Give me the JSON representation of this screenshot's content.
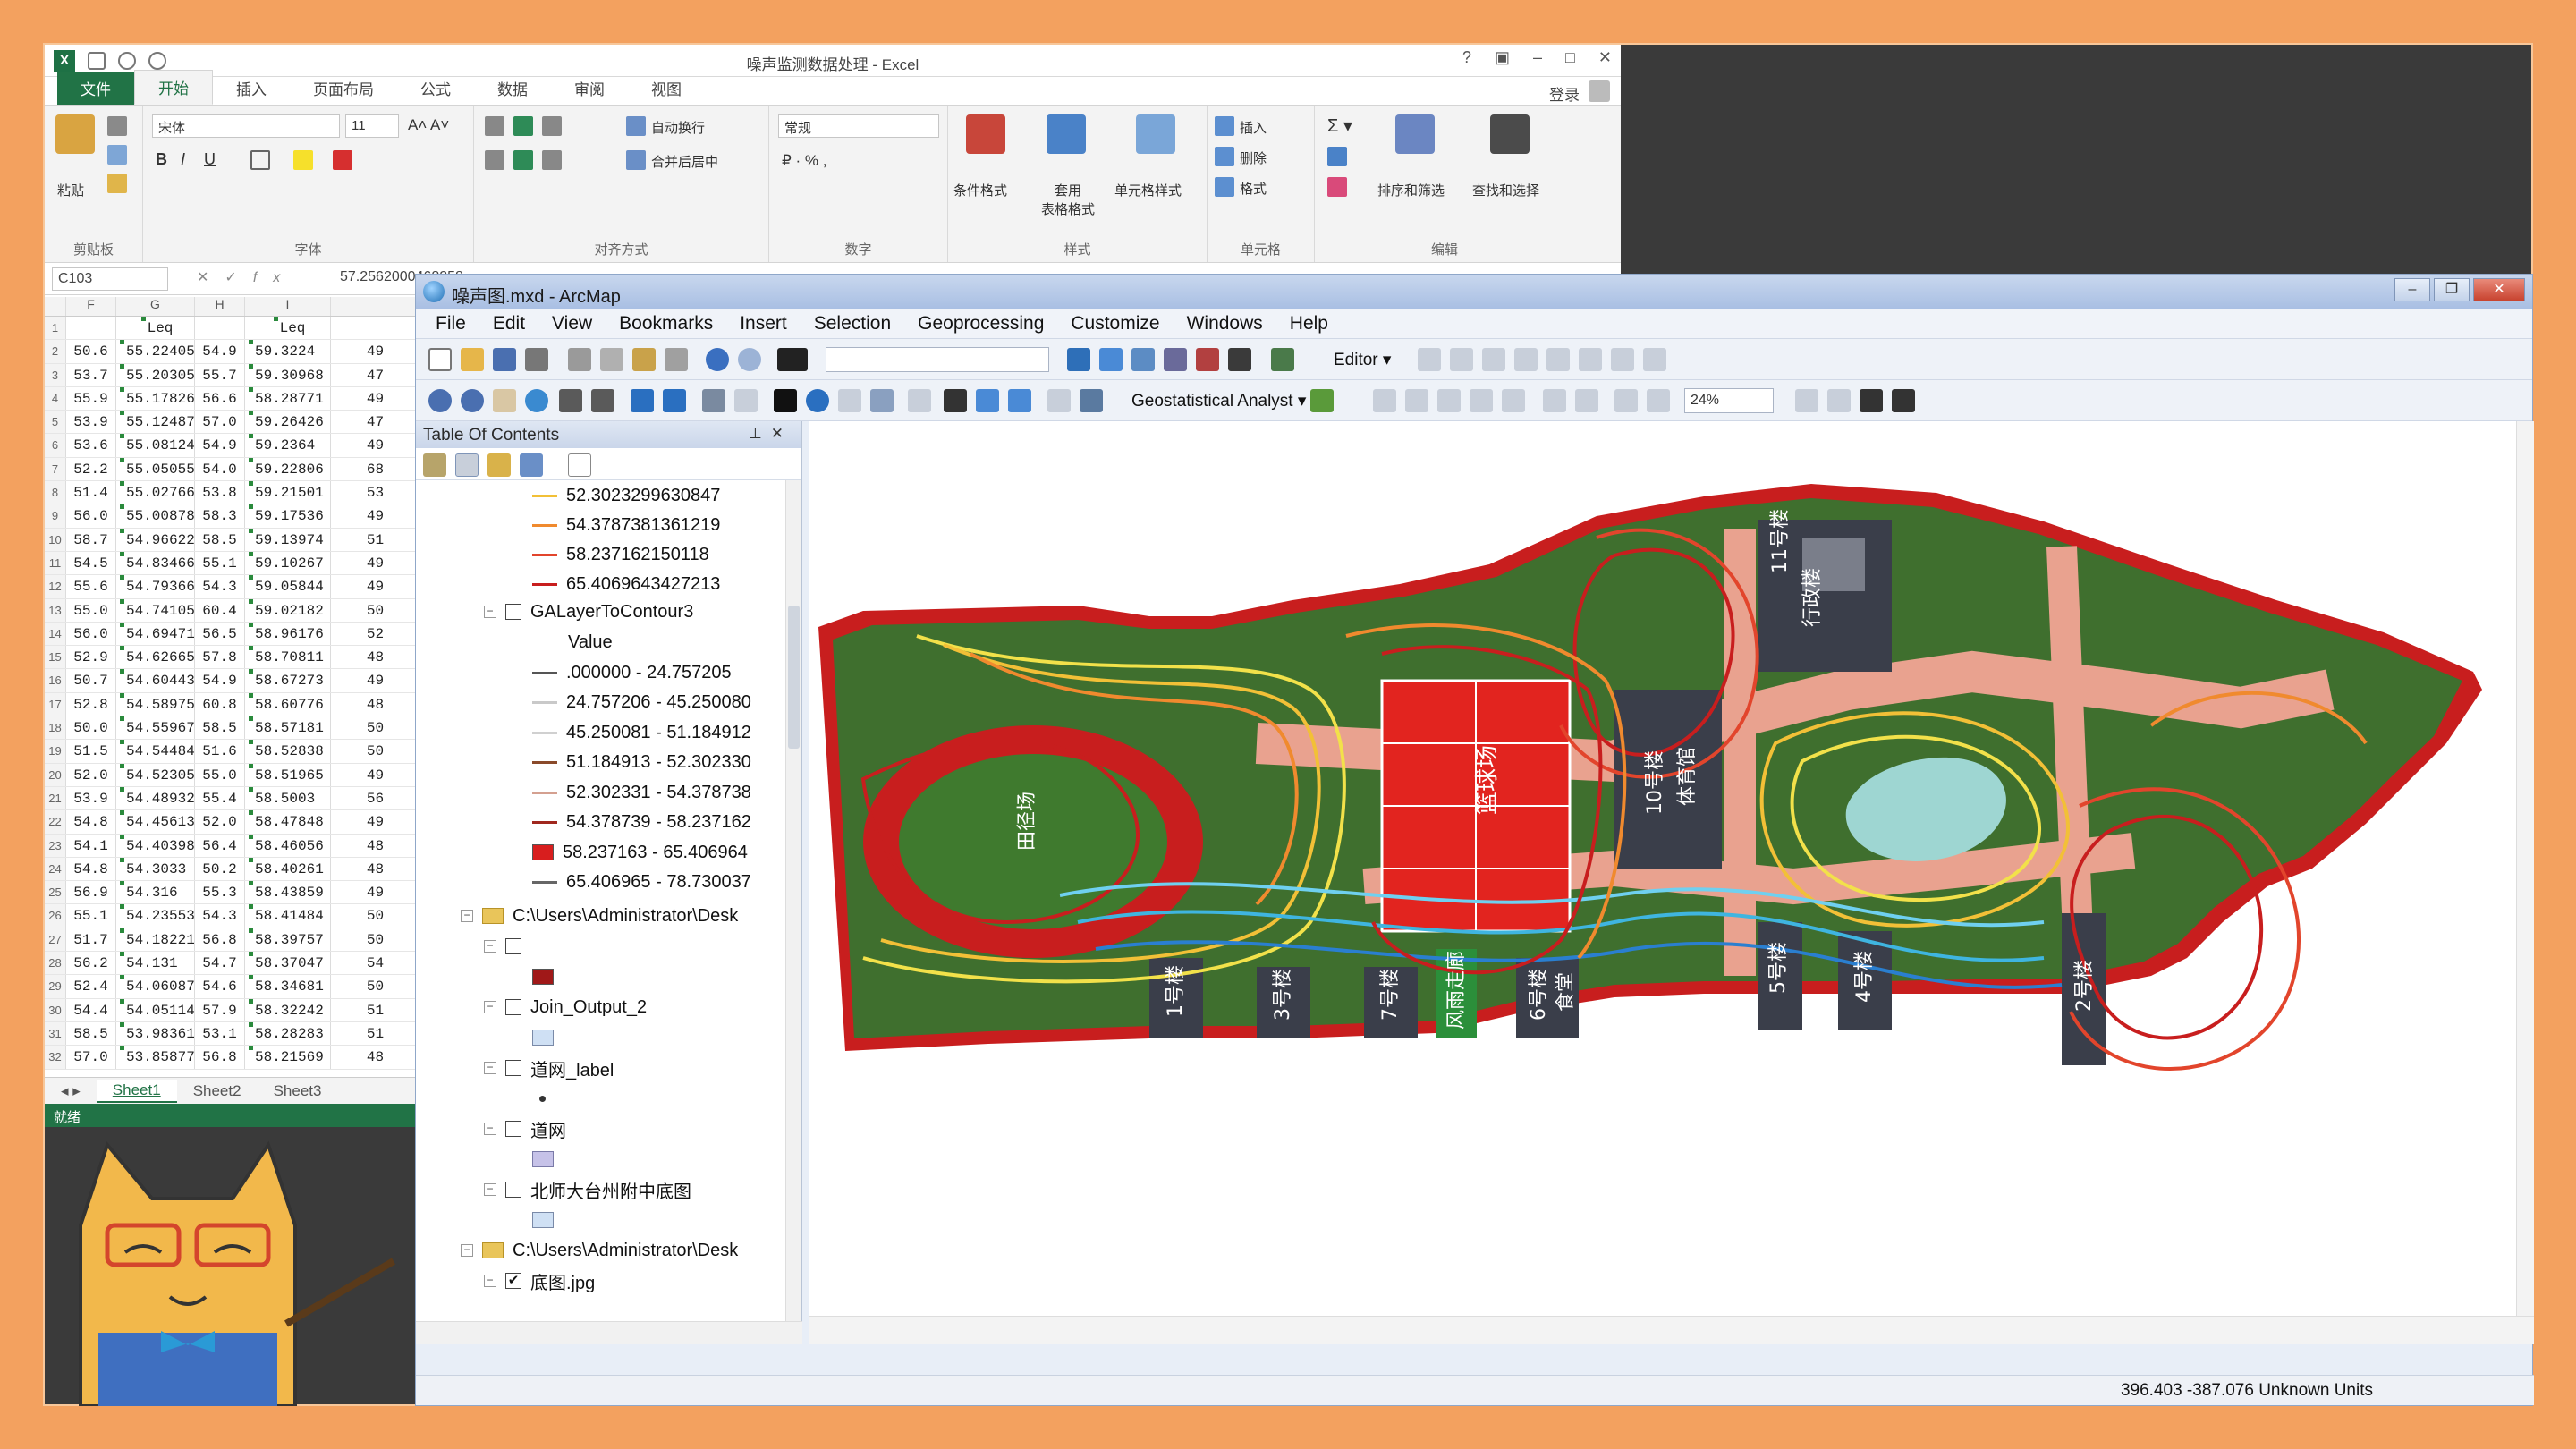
{
  "excel": {
    "title": "噪声监测数据处理 - Excel",
    "tabs": [
      "文件",
      "开始",
      "插入",
      "页面布局",
      "公式",
      "数据",
      "审阅",
      "视图"
    ],
    "active_tab": "开始",
    "login": "登录",
    "ribbon": {
      "paste": "粘贴",
      "clipboard": "剪贴板",
      "font_name": "宋体",
      "font_size": "11",
      "font_group": "字体",
      "bold": "B",
      "italic": "I",
      "underline": "U",
      "wrap_text": "自动换行",
      "merge_center": "合并后居中",
      "align_group": "对齐方式",
      "number_format": "常规",
      "number_group": "数字",
      "cond_format": "条件格式",
      "table_format": "套用\n表格格式",
      "cell_style": "单元格样式",
      "style_group": "样式",
      "insert": "插入",
      "delete": "删除",
      "format": "格式",
      "cells_group": "单元格",
      "sort_filter": "排序和筛选",
      "find_select": "查找和选择",
      "edit_group": "编辑"
    },
    "name_box": "C103",
    "formula": "57.2562000468258",
    "columns": [
      "F",
      "G",
      "H",
      "I"
    ],
    "header_row": [
      "",
      "Leq",
      "",
      "Leq",
      ""
    ],
    "rows": [
      [
        "2",
        "50.6",
        "55.22405",
        "54.9",
        "59.3224",
        "49"
      ],
      [
        "3",
        "53.7",
        "55.20305",
        "55.7",
        "59.30968",
        "47"
      ],
      [
        "4",
        "55.9",
        "55.17826",
        "56.6",
        "58.28771",
        "49"
      ],
      [
        "5",
        "53.9",
        "55.12487",
        "57.0",
        "59.26426",
        "47"
      ],
      [
        "6",
        "53.6",
        "55.08124",
        "54.9",
        "59.2364",
        "49"
      ],
      [
        "7",
        "52.2",
        "55.05055",
        "54.0",
        "59.22806",
        "68"
      ],
      [
        "8",
        "51.4",
        "55.02766",
        "53.8",
        "59.21501",
        "53"
      ],
      [
        "9",
        "56.0",
        "55.00878",
        "58.3",
        "59.17536",
        "49"
      ],
      [
        "10",
        "58.7",
        "54.96622",
        "58.5",
        "59.13974",
        "51"
      ],
      [
        "11",
        "54.5",
        "54.83466",
        "55.1",
        "59.10267",
        "49"
      ],
      [
        "12",
        "55.6",
        "54.79366",
        "54.3",
        "59.05844",
        "49"
      ],
      [
        "13",
        "55.0",
        "54.74105",
        "60.4",
        "59.02182",
        "50"
      ],
      [
        "14",
        "56.0",
        "54.69471",
        "56.5",
        "58.96176",
        "52"
      ],
      [
        "15",
        "52.9",
        "54.62665",
        "57.8",
        "58.70811",
        "48"
      ],
      [
        "16",
        "50.7",
        "54.60443",
        "54.9",
        "58.67273",
        "49"
      ],
      [
        "17",
        "52.8",
        "54.58975",
        "60.8",
        "58.60776",
        "48"
      ],
      [
        "18",
        "50.0",
        "54.55967",
        "58.5",
        "58.57181",
        "50"
      ],
      [
        "19",
        "51.5",
        "54.54484",
        "51.6",
        "58.52838",
        "50"
      ],
      [
        "20",
        "52.0",
        "54.52305",
        "55.0",
        "58.51965",
        "49"
      ],
      [
        "21",
        "53.9",
        "54.48932",
        "55.4",
        "58.5003",
        "56"
      ],
      [
        "22",
        "54.8",
        "54.45613",
        "52.0",
        "58.47848",
        "49"
      ],
      [
        "23",
        "54.1",
        "54.40398",
        "56.4",
        "58.46056",
        "48"
      ],
      [
        "24",
        "54.8",
        "54.3033",
        "50.2",
        "58.40261",
        "48"
      ],
      [
        "25",
        "56.9",
        "54.316",
        "55.3",
        "58.43859",
        "49"
      ],
      [
        "26",
        "55.1",
        "54.23553",
        "54.3",
        "58.41484",
        "50"
      ],
      [
        "27",
        "51.7",
        "54.18221",
        "56.8",
        "58.39757",
        "50"
      ],
      [
        "28",
        "56.2",
        "54.131",
        "54.7",
        "58.37047",
        "54"
      ],
      [
        "29",
        "52.4",
        "54.06087",
        "54.6",
        "58.34681",
        "50"
      ],
      [
        "30",
        "54.4",
        "54.05114",
        "57.9",
        "58.32242",
        "51"
      ],
      [
        "31",
        "58.5",
        "53.98361",
        "53.1",
        "58.28283",
        "51"
      ],
      [
        "32",
        "57.0",
        "53.85877",
        "56.8",
        "58.21569",
        "48"
      ]
    ],
    "sheets": [
      "Sheet1",
      "Sheet2",
      "Sheet3"
    ],
    "status": "就绪"
  },
  "arcmap": {
    "title": "噪声图.mxd - ArcMap",
    "menu": [
      "File",
      "Edit",
      "View",
      "Bookmarks",
      "Insert",
      "Selection",
      "Geoprocessing",
      "Customize",
      "Windows",
      "Help"
    ],
    "editor": "Editor ▾",
    "geostat": "Geostatistical Analyst ▾",
    "zoom": "24%",
    "toc_title": "Table Of Contents",
    "legend_top": [
      {
        "label": "52.3023299630847",
        "color": "#f2c037"
      },
      {
        "label": "54.3787381361219",
        "color": "#f08a2e"
      },
      {
        "label": "58.237162150118",
        "color": "#e2452c"
      },
      {
        "label": "65.4069643427213",
        "color": "#c81e1e"
      }
    ],
    "layer_contour": "GALayerToContour3",
    "value_label": "Value",
    "legend_value": [
      {
        "label": ".000000 - 24.757205",
        "color": "#555555",
        "kind": "line"
      },
      {
        "label": "24.757206 - 45.250080",
        "color": "#c9c9c9",
        "kind": "line"
      },
      {
        "label": "45.250081 - 51.184912",
        "color": "#d0d0d0",
        "kind": "line"
      },
      {
        "label": "51.184913 - 52.302330",
        "color": "#8a4a2a",
        "kind": "line"
      },
      {
        "label": "52.302331 - 54.378738",
        "color": "#d4a090",
        "kind": "line"
      },
      {
        "label": "54.378739 - 58.237162",
        "color": "#a0281e",
        "kind": "line"
      },
      {
        "label": "58.237163 - 65.406964",
        "color": "#d81e1e",
        "kind": "patch"
      },
      {
        "label": "65.406965 - 78.730037",
        "color": "#666666",
        "kind": "line"
      }
    ],
    "group1": "C:\\Users\\Administrator\\Desk",
    "layer_blank": "",
    "layer_join": "Join_Output_2",
    "layer_label": "道网_label",
    "layer_road": "道网",
    "layer_base": "北师大台州附中底图",
    "group2": "C:\\Users\\Administrator\\Desk",
    "layer_jpg": "底图.jpg",
    "map_labels": {
      "b11": "11号楼",
      "b11b": "行政楼",
      "b10": "10号楼",
      "b10b": "体育馆",
      "basket": "篮球场",
      "field": "田径场",
      "b5": "5号楼",
      "b4": "4号楼",
      "b2": "2号楼",
      "b3": "3号楼",
      "b7": "7号楼",
      "b1": "1号楼",
      "b6": "6号楼",
      "b6b": "食堂",
      "food": "风雨走廊"
    },
    "coords": "396.403  -387.076 Unknown Units"
  }
}
